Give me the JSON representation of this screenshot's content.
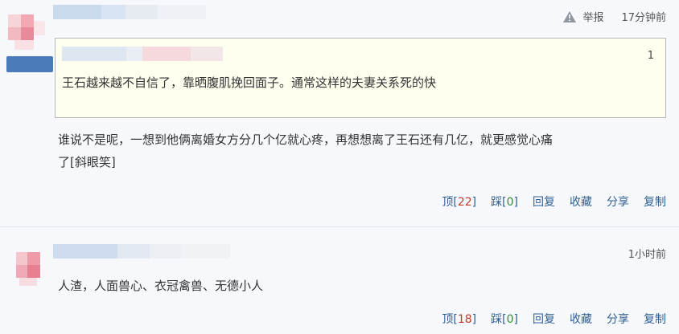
{
  "comments": [
    {
      "time": "17分钟前",
      "report_label": "举报",
      "quote": {
        "floor": "1",
        "text": "王石越来越不自信了，靠晒腹肌挽回面子。通常这样的夫妻关系死的快"
      },
      "body_line1": "谁说不是呢，一想到他俩离婚女方分几个亿就心疼，再想想离了王石还有几亿，就更感觉心痛",
      "body_line2": "了[斜眼笑]",
      "actions": {
        "up_label": "顶",
        "up_open": "[",
        "up_count": "22",
        "up_close": "]",
        "down_label": "踩",
        "down_open": "[",
        "down_count": "0",
        "down_close": "]",
        "reply": "回复",
        "favorite": "收藏",
        "share": "分享",
        "copy": "复制"
      }
    },
    {
      "time": "1小时前",
      "body": "人渣，人面兽心、衣冠禽兽、无德小人",
      "actions": {
        "up_label": "顶",
        "up_open": "[",
        "up_count": "18",
        "up_close": "]",
        "down_label": "踩",
        "down_open": "[",
        "down_count": "0",
        "down_close": "]",
        "reply": "回复",
        "favorite": "收藏",
        "share": "分享",
        "copy": "复制"
      }
    }
  ],
  "icons": {
    "report": "warning-triangle-icon"
  },
  "colors": {
    "link": "#2f5f96",
    "up_count": "#c0392b",
    "down_count": "#2e8b2e",
    "quote_bg": "#fffff0"
  }
}
